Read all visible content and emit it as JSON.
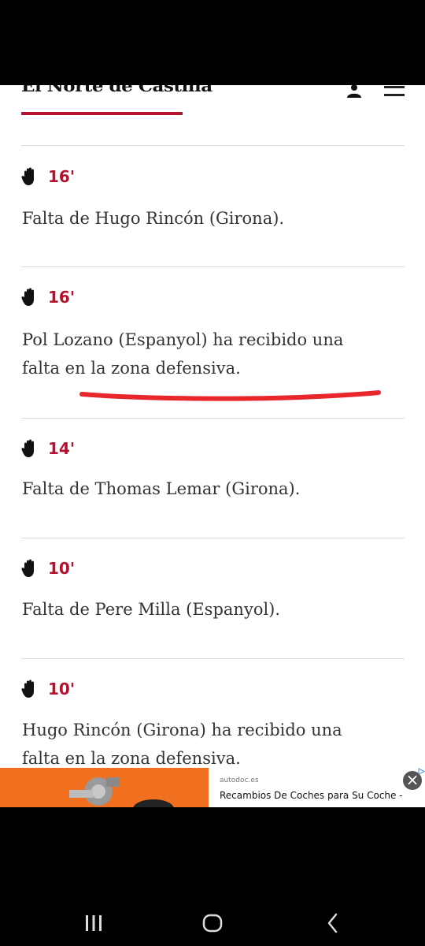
{
  "site": {
    "logo_text": "El Norte de Castilla",
    "accent_color": "#b5122f"
  },
  "header_icons": {
    "user": "user-icon",
    "menu": "menu-icon"
  },
  "entries": [
    {
      "minute": "16'",
      "text": "Falta de Hugo Rincón (Girona).",
      "icon": "hand-icon"
    },
    {
      "minute": "16'",
      "text": "Pol Lozano (Espanyol) ha recibido una falta en la zona defensiva.",
      "icon": "hand-icon",
      "annotation": "red-underline"
    },
    {
      "minute": "14'",
      "text": "Falta de Thomas Lemar (Girona).",
      "icon": "hand-icon"
    },
    {
      "minute": "10'",
      "text": "Falta de Pere Milla (Espanyol).",
      "icon": "hand-icon"
    },
    {
      "minute": "10'",
      "text": "Hugo Rincón (Girona) ha recibido una falta en la zona defensiva.",
      "icon": "hand-icon"
    }
  ],
  "ad": {
    "source": "autodoc.es",
    "title": "Recambios De Coches para Su Coche -",
    "close_label": "×",
    "bg_color": "#f07020"
  },
  "nav": {
    "recents": "recents-icon",
    "home": "home-icon",
    "back": "back-icon"
  }
}
